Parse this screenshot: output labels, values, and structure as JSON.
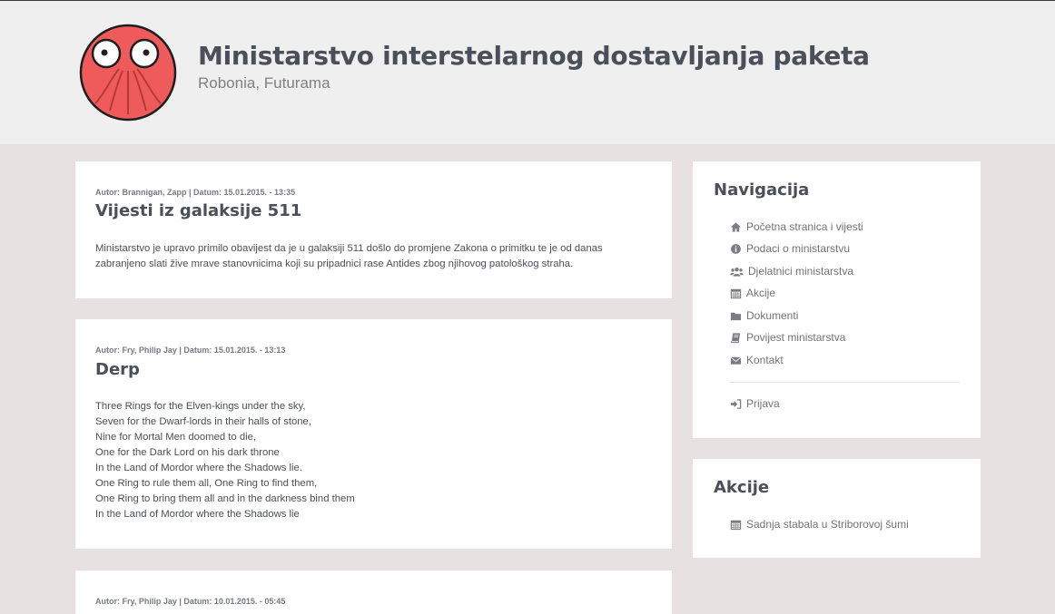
{
  "header": {
    "title": "Ministarstvo interstelarnog dostavljanja paketa",
    "subtitle": "Robonia, Futurama",
    "logo_icon": "zoidberg-logo-icon"
  },
  "posts": [
    {
      "meta": "Autor: Brannigan, Zapp | Datum: 15.01.2015. - 13:35",
      "title": "Vijesti iz galaksije 511",
      "lines": [
        "Ministarstvo je upravo primilo obavijest da je u galaksiji 511 došlo do promjene Zakona o primitku te je od danas",
        "zabranjeno slati žive mrave stanovnicima koji su pripadnici rase Antides zbog njihovog patološkog straha."
      ]
    },
    {
      "meta": "Autor: Fry, Philip Jay | Datum: 15.01.2015. - 13:13",
      "title": "Derp",
      "lines": [
        "Three Rings for the Elven-kings under the sky,",
        "Seven for the Dwarf-lords in their halls of stone,",
        "Nine for Mortal Men doomed to die,",
        "One for the Dark Lord on his dark throne",
        "In the Land of Mordor where the Shadows lie.",
        "One Ring to rule them all, One Ring to find them,",
        "One Ring to bring them all and in the darkness bind them",
        "In the Land of Mordor where the Shadows lie"
      ]
    },
    {
      "meta": "Autor: Fry, Philip Jay | Datum: 10.01.2015. - 05:45"
    }
  ],
  "sidebar": {
    "nav_title": "Navigacija",
    "nav_items": [
      {
        "label": "Početna stranica i vijesti",
        "icon": "home-icon"
      },
      {
        "label": "Podaci o ministarstvu",
        "icon": "info-circle-icon"
      },
      {
        "label": "Djelatnici ministarstva",
        "icon": "users-icon"
      },
      {
        "label": "Akcije",
        "icon": "calendar-icon"
      },
      {
        "label": "Dokumenti",
        "icon": "folder-icon"
      },
      {
        "label": "Povijest ministarstva",
        "icon": "book-icon"
      },
      {
        "label": "Kontakt",
        "icon": "envelope-icon"
      }
    ],
    "login": {
      "label": "Prijava",
      "icon": "sign-in-icon"
    },
    "actions_title": "Akcije",
    "actions": [
      {
        "label": "Sadnja stabala u Striborovoj šumi",
        "icon": "calendar-icon"
      }
    ]
  },
  "colors": {
    "page_bg": "#e7e1e1",
    "header_bg": "#efefef",
    "logo_red": "#ef5b5b",
    "text_dark": "#4a4f5a",
    "icon_grey": "#7a7d83"
  }
}
